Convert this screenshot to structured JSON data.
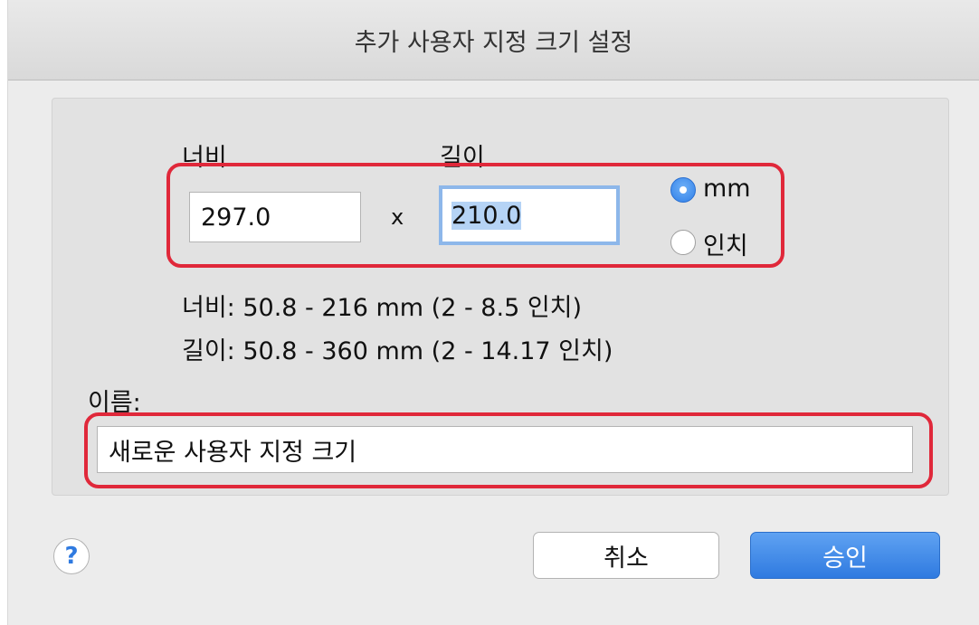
{
  "window": {
    "title": "추가 사용자 지정 크기 설정"
  },
  "size": {
    "width_label": "너비",
    "length_label": "길이",
    "width_value": "297.0",
    "length_value": "210.0",
    "times_sign": "x",
    "units": [
      {
        "label": "mm",
        "selected": true
      },
      {
        "label": "인치",
        "selected": false
      }
    ],
    "width_range": "너비: 50.8 - 216 mm (2 - 8.5 인치)",
    "length_range": "길이: 50.8 - 360 mm (2 - 14.17 인치)"
  },
  "name": {
    "label": "이름:",
    "value": "새로운 사용자 지정 크기"
  },
  "buttons": {
    "help": "?",
    "cancel": "취소",
    "ok": "승인"
  },
  "colors": {
    "accent": "#2f7ae0",
    "annotation": "#e0283a",
    "focus_ring": "#8db7ea",
    "selection": "#b5d3f5"
  }
}
